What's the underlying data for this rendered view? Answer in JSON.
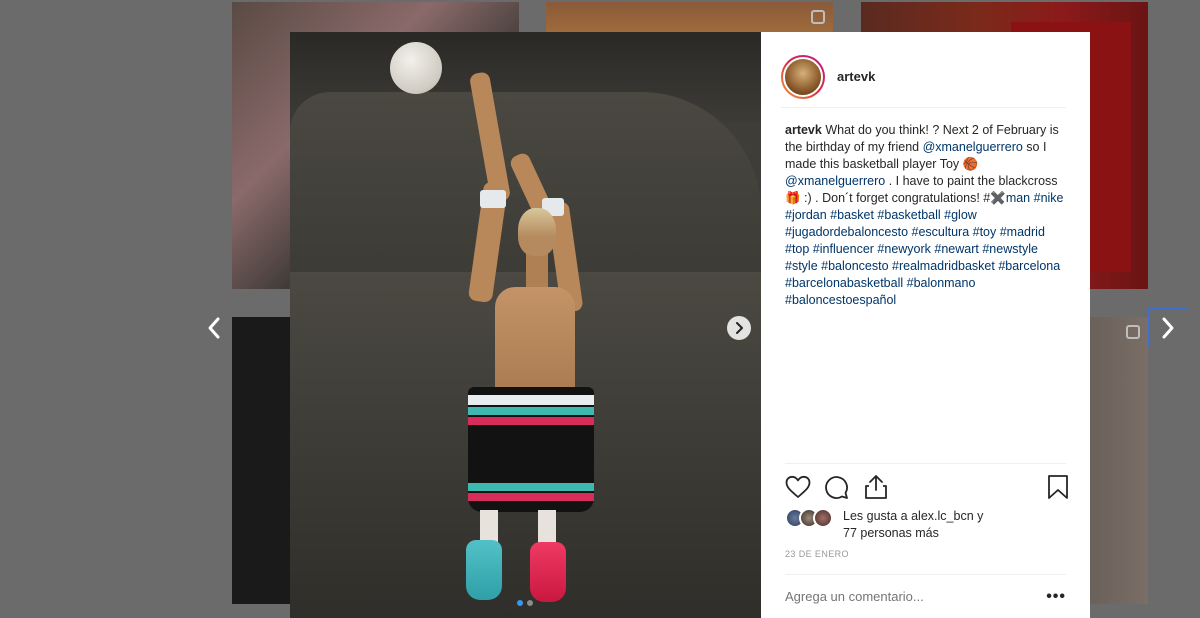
{
  "post": {
    "username": "artevk",
    "caption_user": "artevk",
    "caption_parts": [
      " What do you think! ? Next 2 of February is the birthday of my friend ",
      "@xmanelguerrero",
      " so I made this basketball player Toy 🏀 ",
      "@xmanelguerrero",
      " . I have to paint the blackcross 🎁 :) . Don´t forget congratulations! #",
      "✖️man",
      " ",
      "#nike #jordan #basket #basketball #glow #jugadordebaloncesto #escultura #toy #madrid #top #influencer #newyork #newart #newstyle #style #baloncesto #realmadridbasket #barcelona #barcelonabasketball #balonmano #baloncestoespañol"
    ],
    "likes_line1": "Les gusta a alex.lc_bcn y",
    "likes_line2": "77 personas más",
    "date": "23 DE ENERO",
    "comment_placeholder": "Agrega un comentario...",
    "more_label": "•••"
  },
  "icons": {
    "like": "heart-icon",
    "comment": "comment-icon",
    "share": "share-icon",
    "save": "bookmark-icon",
    "prev": "chevron-left-icon",
    "next": "chevron-right-icon"
  },
  "carousel": {
    "slides": 2,
    "active": 1
  },
  "colors": {
    "link": "#003569",
    "accent": "#3897f0",
    "text": "#262626",
    "muted": "#999999"
  }
}
